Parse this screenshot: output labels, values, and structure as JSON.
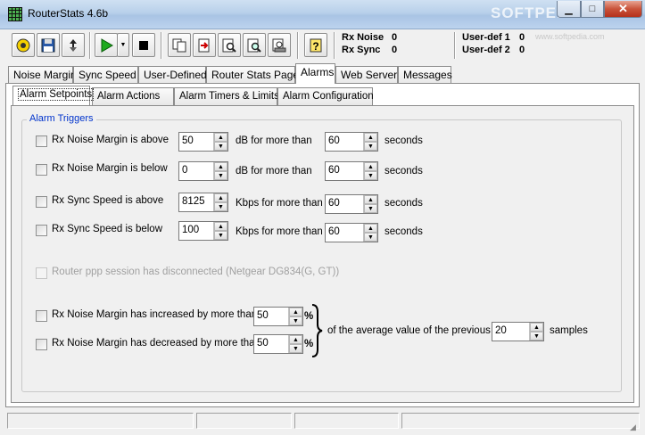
{
  "window": {
    "title": "RouterStats 4.6b",
    "watermark": "SOFTPEDIA",
    "watermark_url": "www.softpedia.com"
  },
  "stats": {
    "rx_noise_label": "Rx Noise",
    "rx_noise_value": "0",
    "rx_sync_label": "Rx Sync",
    "rx_sync_value": "0",
    "userdef1_label": "User-def 1",
    "userdef1_value": "0",
    "userdef2_label": "User-def 2",
    "userdef2_value": "0"
  },
  "main_tabs": [
    "Noise Margin",
    "Sync Speed",
    "User-Defined",
    "Router Stats Page",
    "Alarms",
    "Web Server",
    "Messages"
  ],
  "sub_tabs": [
    "Alarm Setpoints",
    "Alarm Actions",
    "Alarm Timers & Limits",
    "Alarm Configuration"
  ],
  "group_title": "Alarm Triggers",
  "alarms": [
    {
      "label": "Rx Noise Margin is above",
      "value": "50",
      "unit": "dB for more than",
      "seconds": "60",
      "seconds_label": "seconds"
    },
    {
      "label": "Rx Noise Margin is below",
      "value": "0",
      "unit": "dB for more than",
      "seconds": "60",
      "seconds_label": "seconds"
    },
    {
      "label": "Rx Sync Speed is above",
      "value": "8125",
      "unit": "Kbps for more than",
      "seconds": "60",
      "seconds_label": "seconds"
    },
    {
      "label": "Rx Sync Speed is below",
      "value": "100",
      "unit": "Kbps for more than",
      "seconds": "60",
      "seconds_label": "seconds"
    }
  ],
  "ppp_label": "Router ppp session has disconnected (Netgear DG834(G, GT))",
  "change_alarms": [
    {
      "label": "Rx Noise Margin has increased by more than",
      "value": "50",
      "unit": "%"
    },
    {
      "label": "Rx Noise Margin has decreased by more than",
      "value": "50",
      "unit": "%"
    }
  ],
  "average_text": "of the average value of the previous",
  "samples_value": "20",
  "samples_label": "samples"
}
